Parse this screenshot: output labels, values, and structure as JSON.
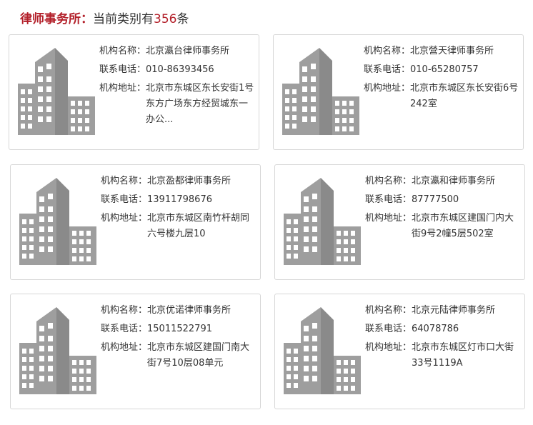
{
  "header": {
    "label": "律师事务所：",
    "prefix": "当前类别有",
    "count": "356",
    "suffix": "条"
  },
  "field_labels": {
    "name": "机构名称：",
    "phone": "联系电话：",
    "address": "机构地址："
  },
  "colors": {
    "accent": "#b3202a",
    "building": "#9e9e9e",
    "border": "#d7d7d7"
  },
  "icon": "building-icon",
  "firms": [
    {
      "name": "北京瀛台律师事务所",
      "phone": "010-86393456",
      "address": "北京市东城区东长安街1号东方广场东方经贸城东一办公..."
    },
    {
      "name": "北京營天律师事务所",
      "phone": "010-65280757",
      "address": "北京市东城区东长安街6号242室"
    },
    {
      "name": "北京盈都律师事务所",
      "phone": "13911798676",
      "address": "北京市东城区南竹杆胡同六号楼九层10"
    },
    {
      "name": "北京瀛和律师事务所",
      "phone": "87777500",
      "address": "北京市东城区建国门内大街9号2幢5层502室"
    },
    {
      "name": "北京优诺律师事务所",
      "phone": "15011522791",
      "address": "北京市东城区建国门南大街7号10层08单元"
    },
    {
      "name": "北京元陆律师事务所",
      "phone": "64078786",
      "address": "北京市东城区灯市口大街33号1119A"
    }
  ]
}
